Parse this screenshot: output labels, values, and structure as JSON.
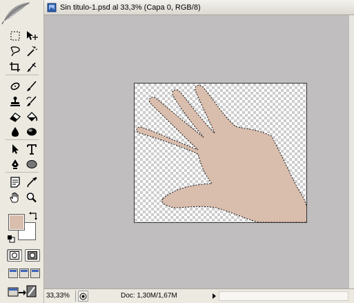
{
  "window": {
    "title": "Sin titulo-1.psd al 33,3% (Capa 0, RGB/8)"
  },
  "status_bar": {
    "zoom": "33,33%",
    "doc_info": "Doc: 1,30M/1,67M"
  },
  "colors": {
    "foreground": "#d9bdad",
    "background": "#ffffff",
    "workspace": "#c0bebe",
    "hand": "#d9bdad"
  },
  "tools": [
    {
      "name": "rectangular-marquee-icon"
    },
    {
      "name": "move-icon"
    },
    {
      "name": "lasso-icon"
    },
    {
      "name": "magic-wand-icon"
    },
    {
      "name": "crop-icon"
    },
    {
      "name": "slice-icon"
    },
    {
      "name": "healing-brush-icon"
    },
    {
      "name": "brush-icon"
    },
    {
      "name": "clone-stamp-icon"
    },
    {
      "name": "history-brush-icon"
    },
    {
      "name": "eraser-icon"
    },
    {
      "name": "paint-bucket-icon"
    },
    {
      "name": "blur-icon"
    },
    {
      "name": "dodge-icon"
    },
    {
      "name": "path-selection-icon"
    },
    {
      "name": "type-icon"
    },
    {
      "name": "pen-icon"
    },
    {
      "name": "ellipse-icon"
    },
    {
      "name": "notes-icon"
    },
    {
      "name": "eyedropper-icon"
    },
    {
      "name": "hand-icon"
    },
    {
      "name": "zoom-icon"
    }
  ]
}
